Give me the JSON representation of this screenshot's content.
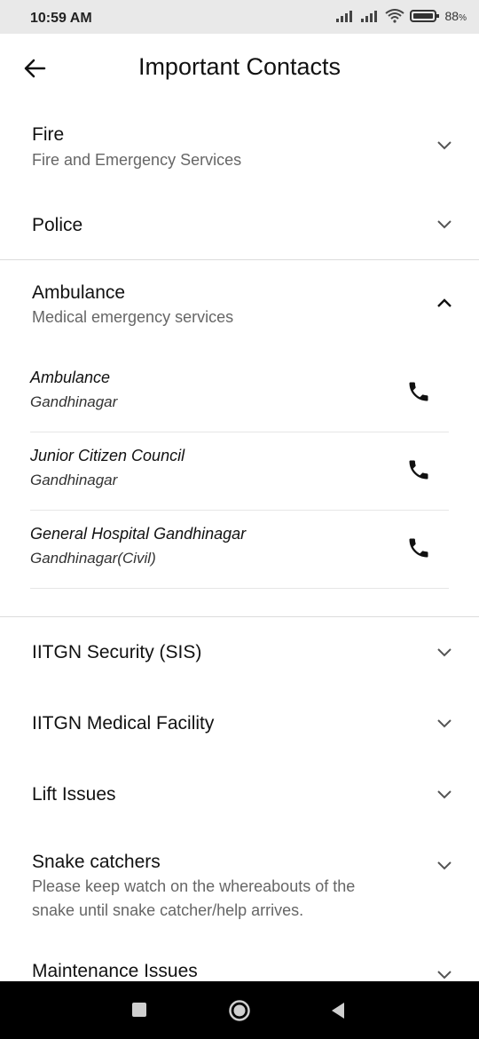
{
  "status": {
    "time": "10:59 AM",
    "battery": "88",
    "battery_unit": "%"
  },
  "header": {
    "title": "Important Contacts"
  },
  "sections": [
    {
      "title": "Fire",
      "subtitle": "Fire and Emergency Services"
    },
    {
      "title": "Police"
    },
    {
      "title": "Ambulance",
      "subtitle": "Medical emergency services"
    },
    {
      "title": "IITGN Security (SIS)"
    },
    {
      "title": "IITGN Medical Facility"
    },
    {
      "title": "Lift Issues"
    },
    {
      "title": "Snake catchers",
      "subtitle": "Please keep watch on the whereabouts of the",
      "subtitle2": "snake until snake catcher/help arrives."
    },
    {
      "title": "Maintenance Issues"
    }
  ],
  "ambulance_contacts": [
    {
      "name": "Ambulance",
      "location": "Gandhinagar"
    },
    {
      "name": "Junior Citizen Council",
      "location": "Gandhinagar"
    },
    {
      "name": "General Hospital Gandhinagar",
      "location": "Gandhinagar(Civil)"
    }
  ]
}
